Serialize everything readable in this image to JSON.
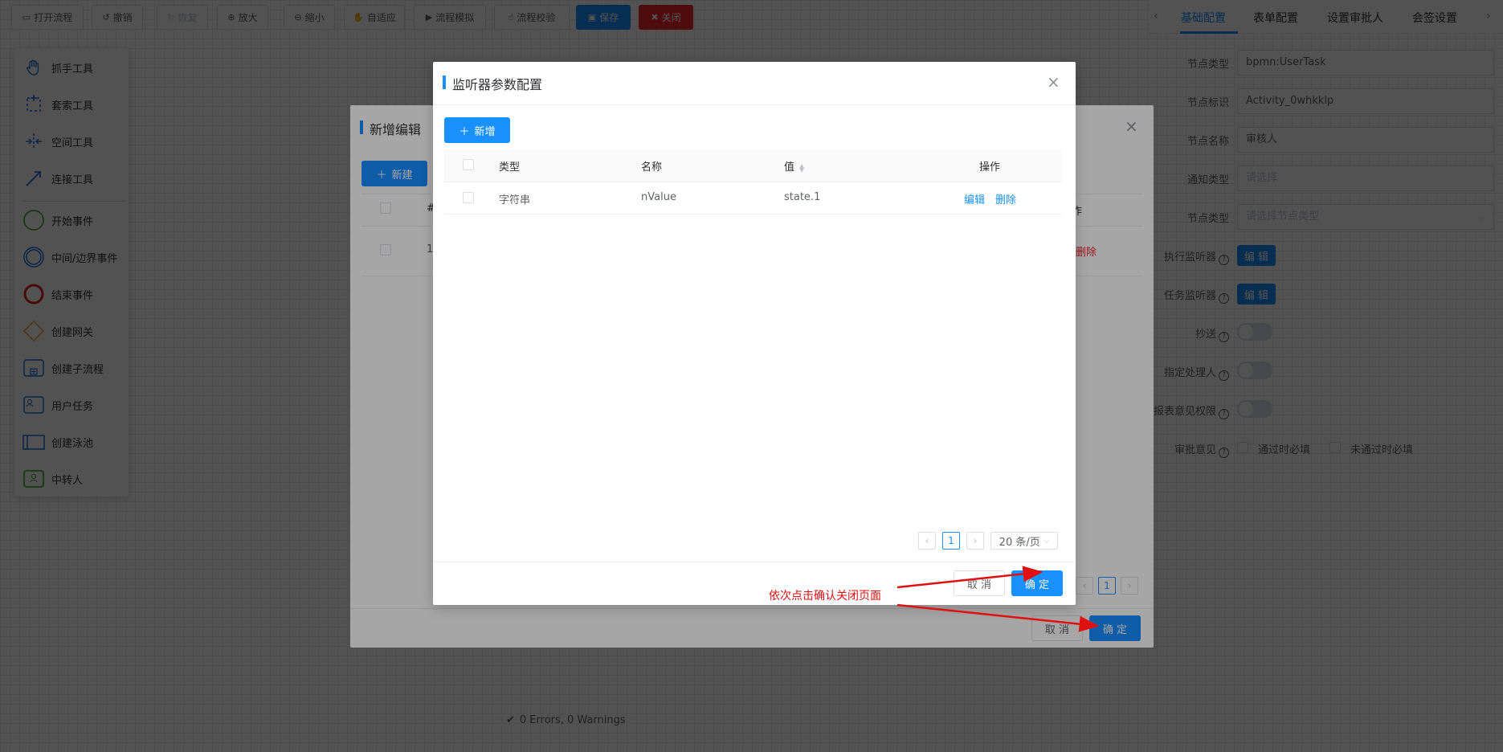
{
  "toolbar": {
    "open_flow": "打开流程",
    "undo": "撤销",
    "redo": "恢复",
    "zoom_in": "放大",
    "zoom_out": "缩小",
    "fit": "自适应",
    "simulate": "流程模拟",
    "validate": "流程校验",
    "save": "保存",
    "close": "关闭"
  },
  "right_panel": {
    "tabs": [
      "基础配置",
      "表单配置",
      "设置审批人",
      "会签设置"
    ],
    "active_tab": "基础配置",
    "node_type_label": "节点类型",
    "node_type_value": "bpmn:UserTask",
    "node_id_label": "节点标识",
    "node_id_value": "Activity_0whkklp",
    "node_name_label": "节点名称",
    "node_name_value": "审核人",
    "notify_type_label": "通知类型",
    "notify_type_placeholder": "请选择",
    "node_kind_label": "节点类型",
    "node_kind_placeholder": "请选择节点类型",
    "exec_listener_label": "执行监听器",
    "task_listener_label": "任务监听器",
    "edit_label": "编 辑",
    "cc_label": "抄送",
    "assign_label": "指定处理人",
    "report_opinion_label": "报表意见权限",
    "approve_opinion_label": "审批意见",
    "pass_required": "通过时必填",
    "reject_required": "未通过时必填"
  },
  "palette": {
    "items": [
      "抓手工具",
      "套索工具",
      "空间工具",
      "连接工具",
      "开始事件",
      "中间/边界事件",
      "结束事件",
      "创建网关",
      "创建子流程",
      "用户任务",
      "创建泳池",
      "中转人"
    ]
  },
  "status": {
    "text": "0 Errors, 0 Warnings"
  },
  "dialog_back": {
    "title": "新增编辑",
    "new_button": "新建",
    "hash_col": "#",
    "op_col_partial": "作",
    "row_index": "1",
    "row_delete_partial": "删除",
    "page": "1",
    "cancel": "取 消",
    "confirm": "确 定"
  },
  "dialog_front": {
    "title": "监听器参数配置",
    "add_button": "新增",
    "columns": {
      "type": "类型",
      "name": "名称",
      "value": "值",
      "action": "操作"
    },
    "rows": [
      {
        "type": "字符串",
        "name": "nValue",
        "value": "state.1",
        "edit": "编辑",
        "delete": "删除"
      }
    ],
    "pagination": {
      "current": "1",
      "page_size": "20 条/页"
    },
    "cancel": "取 消",
    "confirm": "确 定"
  },
  "annotation": {
    "text": "依次点击确认关闭页面",
    "color": "#e01010"
  },
  "colors": {
    "primary": "#1890ff",
    "danger": "#f5222d"
  }
}
